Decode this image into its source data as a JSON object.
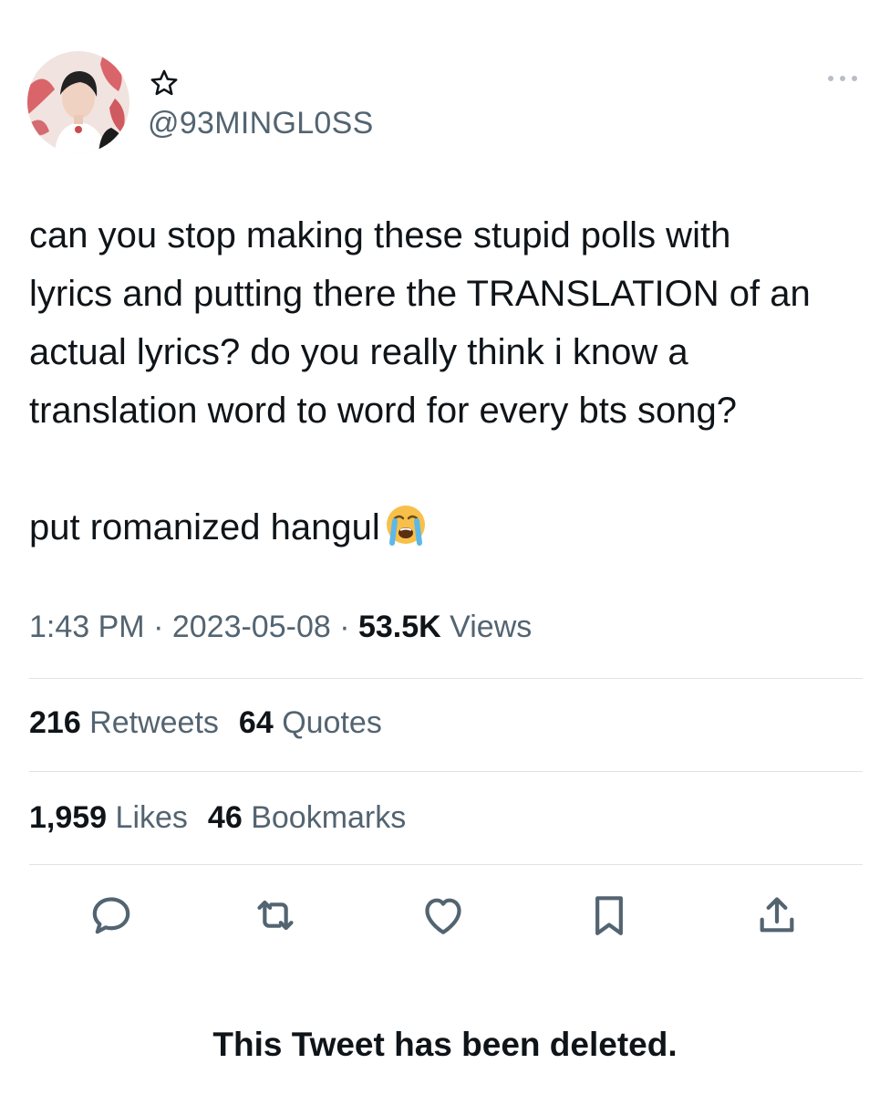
{
  "author": {
    "handle": "@93MINGL0SS",
    "avatar_icon": "profile-photo",
    "name_icon": "star-outline-icon"
  },
  "tweet": {
    "text": "can you stop making these stupid polls with\nlyrics and putting there the TRANSLATION of an\nactual lyrics? do you really think i know a\ntranslation word to word for every bts song?\n\nput romanized hangul",
    "emoji": "loudly-crying-face-emoji"
  },
  "meta": {
    "time": "1:43 PM",
    "sep1": " · ",
    "date": "2023-05-08",
    "sep2": " · ",
    "views_count": "53.5K",
    "views_label": " Views"
  },
  "stats": {
    "retweets_count": "216",
    "retweets_label": " Retweets",
    "quotes_count": "64",
    "quotes_label": " Quotes",
    "likes_count": "1,959",
    "likes_label": " Likes",
    "bookmarks_count": "46",
    "bookmarks_label": " Bookmarks"
  },
  "actions": [
    "reply-icon",
    "retweet-icon",
    "like-icon",
    "bookmark-icon",
    "share-icon"
  ],
  "footer": {
    "deleted_notice": "This Tweet has been deleted."
  },
  "colors": {
    "text": "#0f1419",
    "secondary": "#536471",
    "divider": "#dfe3e6",
    "emoji_yellow": "#f7c04a"
  }
}
